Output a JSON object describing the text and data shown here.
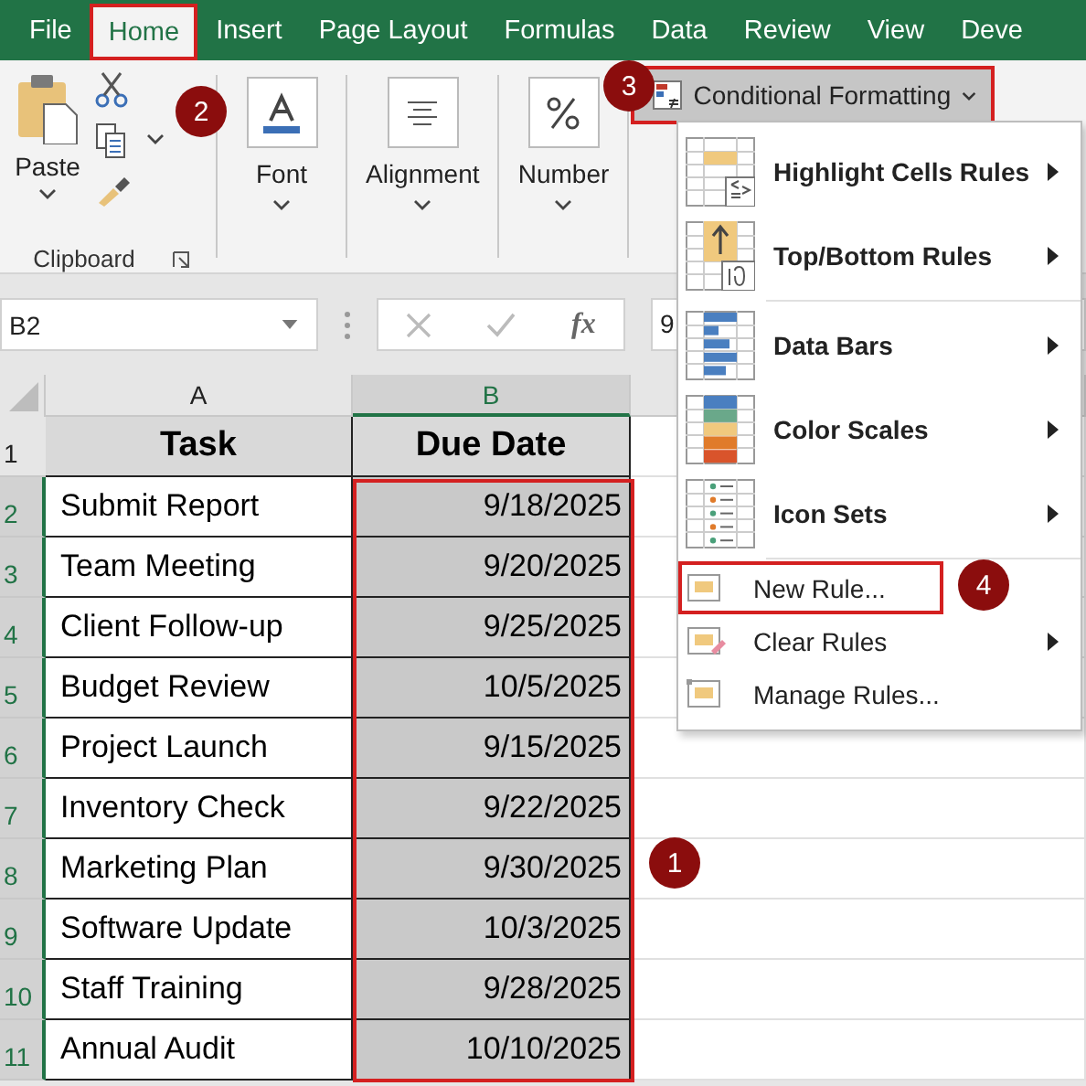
{
  "tabs": [
    {
      "label": "File",
      "selected": false,
      "outlined": false
    },
    {
      "label": "Home",
      "selected": true,
      "outlined": true
    },
    {
      "label": "Insert",
      "selected": false,
      "outlined": false
    },
    {
      "label": "Page Layout",
      "selected": false,
      "outlined": false
    },
    {
      "label": "Formulas",
      "selected": false,
      "outlined": false
    },
    {
      "label": "Data",
      "selected": false,
      "outlined": false
    },
    {
      "label": "Review",
      "selected": false,
      "outlined": false
    },
    {
      "label": "View",
      "selected": false,
      "outlined": false
    },
    {
      "label": "Deve",
      "selected": false,
      "outlined": false
    }
  ],
  "ribbon": {
    "clipboard": {
      "paste_label": "Paste",
      "group_label": "Clipboard"
    },
    "groups": [
      {
        "label": "Font"
      },
      {
        "label": "Alignment"
      },
      {
        "label": "Number"
      }
    ],
    "conditional_formatting": {
      "label": "Conditional Formatting",
      "outlined": true
    }
  },
  "formula_bar": {
    "name_box": "B2",
    "fx": "fx",
    "value": "9"
  },
  "sheet": {
    "columns": [
      {
        "label": "A",
        "selected": false
      },
      {
        "label": "B",
        "selected": true
      }
    ],
    "range_outline": true,
    "header_row": {
      "number": "1",
      "cells": [
        "Task",
        "Due Date"
      ]
    },
    "rows": [
      {
        "number": "2",
        "task": "Submit Report",
        "due": "9/18/2025",
        "selected": true
      },
      {
        "number": "3",
        "task": "Team Meeting",
        "due": "9/20/2025",
        "selected": true
      },
      {
        "number": "4",
        "task": "Client Follow-up",
        "due": "9/25/2025",
        "selected": true
      },
      {
        "number": "5",
        "task": "Budget Review",
        "due": "10/5/2025",
        "selected": true
      },
      {
        "number": "6",
        "task": "Project Launch",
        "due": "9/15/2025",
        "selected": true
      },
      {
        "number": "7",
        "task": "Inventory Check",
        "due": "9/22/2025",
        "selected": true
      },
      {
        "number": "8",
        "task": "Marketing Plan",
        "due": "9/30/2025",
        "selected": true
      },
      {
        "number": "9",
        "task": "Software Update",
        "due": "10/3/2025",
        "selected": true
      },
      {
        "number": "10",
        "task": "Staff Training",
        "due": "9/28/2025",
        "selected": true
      },
      {
        "number": "11",
        "task": "Annual Audit",
        "due": "10/10/2025",
        "selected": true
      }
    ]
  },
  "menu": {
    "items": [
      {
        "kind": "large",
        "label": "Highlight Cells Rules",
        "submenu": true,
        "outlined": false
      },
      {
        "kind": "large",
        "label": "Top/Bottom Rules",
        "submenu": true,
        "outlined": false
      },
      {
        "kind": "large",
        "label": "Data Bars",
        "submenu": true,
        "outlined": false
      },
      {
        "kind": "large",
        "label": "Color Scales",
        "submenu": true,
        "outlined": false
      },
      {
        "kind": "large",
        "label": "Icon Sets",
        "submenu": true,
        "outlined": false
      },
      {
        "kind": "small",
        "label": "New Rule...",
        "submenu": false,
        "outlined": true
      },
      {
        "kind": "small",
        "label": "Clear Rules",
        "submenu": true,
        "outlined": false
      },
      {
        "kind": "small",
        "label": "Manage Rules...",
        "submenu": false,
        "outlined": false
      }
    ]
  },
  "callouts": [
    {
      "number": "1"
    },
    {
      "number": "2"
    },
    {
      "number": "3"
    },
    {
      "number": "4"
    }
  ]
}
